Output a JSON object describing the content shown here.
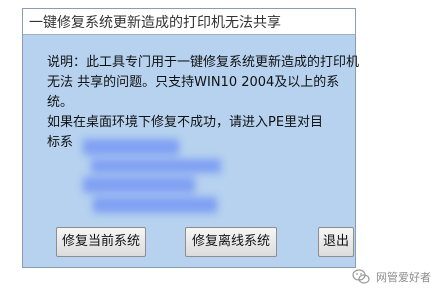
{
  "window": {
    "title": "一键修复系统更新造成的打印机无法共享"
  },
  "description": {
    "lines": [
      "说明：此工具专门用于一键修复系统更新造成的打印机",
      "无法  共享的问题。只支持WIN10 2004及以上的系",
      "统。",
      "        如果在桌面环境下修复不成功，请进入PE里对目",
      "标系"
    ]
  },
  "buttons": {
    "repair_current": "修复当前系统",
    "repair_offline": "修复离线系统",
    "exit": "退出"
  },
  "watermark": {
    "text": "网管爱好者",
    "icon": "wechat-icon"
  },
  "colors": {
    "client_background": "#b6d2ef",
    "redaction_blur": "#7f9ff3"
  }
}
